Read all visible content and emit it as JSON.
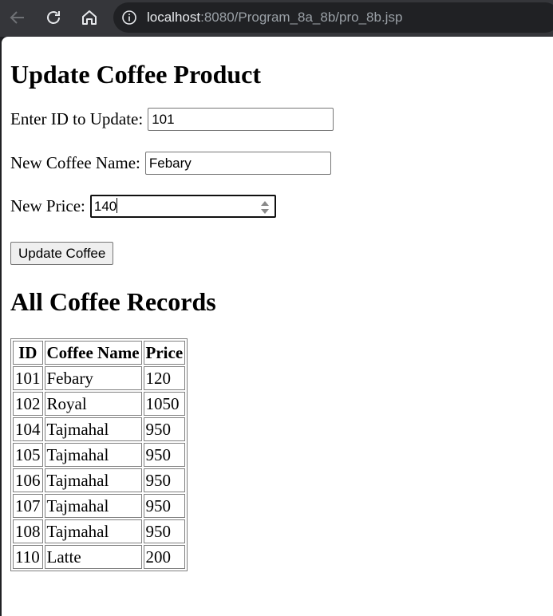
{
  "browser": {
    "url_host": "localhost",
    "url_rest": ":8080/Program_8a_8b/pro_8b.jsp"
  },
  "form": {
    "title": "Update Coffee Product",
    "id_label": "Enter ID to Update:",
    "id_value": "101",
    "name_label": "New Coffee Name:",
    "name_value": "Febary",
    "price_label": "New Price:",
    "price_value": "140",
    "submit_label": "Update Coffee"
  },
  "records": {
    "title": "All Coffee Records",
    "columns": [
      "ID",
      "Coffee Name",
      "Price"
    ],
    "rows": [
      [
        "101",
        "Febary",
        "120"
      ],
      [
        "102",
        "Royal",
        "1050"
      ],
      [
        "104",
        "Tajmahal",
        "950"
      ],
      [
        "105",
        "Tajmahal",
        "950"
      ],
      [
        "106",
        "Tajmahal",
        "950"
      ],
      [
        "107",
        "Tajmahal",
        "950"
      ],
      [
        "108",
        "Tajmahal",
        "950"
      ],
      [
        "110",
        "Latte",
        "200"
      ]
    ]
  }
}
